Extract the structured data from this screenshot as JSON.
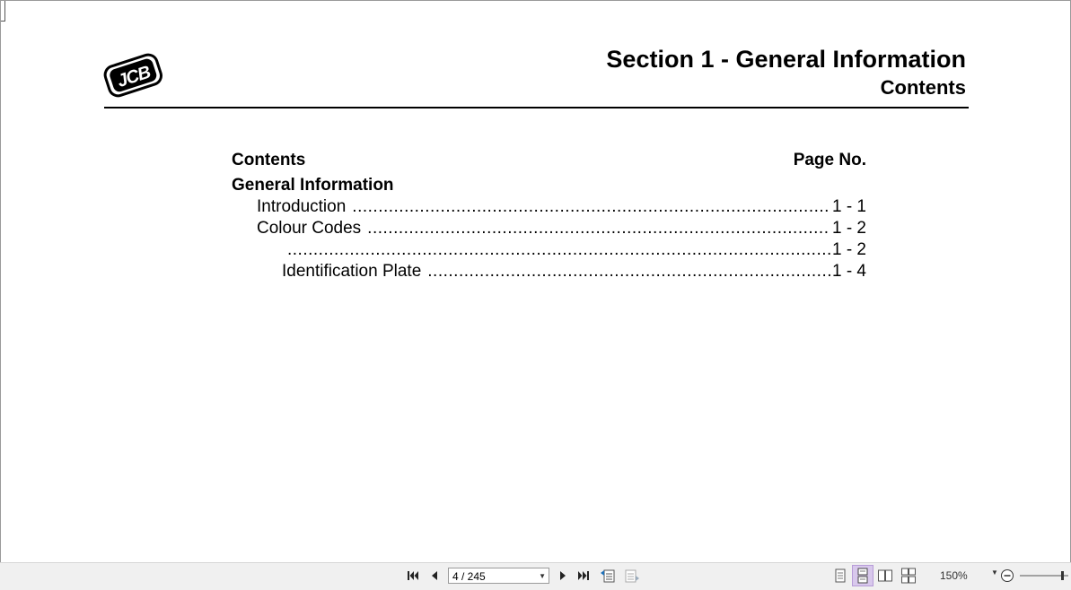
{
  "document": {
    "logo_text": "JCB",
    "section_title": "Section 1 - General Information",
    "section_subtitle": "Contents"
  },
  "toc": {
    "header_left": "Contents",
    "header_right": "Page No.",
    "group_title": "General Information",
    "entries": [
      {
        "label": "Introduction",
        "page": "1 - 1",
        "level": 1
      },
      {
        "label": "Colour Codes",
        "page": "1 - 2",
        "level": 1
      },
      {
        "label": "",
        "page": "1 - 2",
        "level": 2
      },
      {
        "label": "Identification Plate",
        "page": "1 - 4",
        "level": 2
      }
    ]
  },
  "toolbar": {
    "page_indicator": "4 / 245",
    "zoom_level": "150%",
    "icons": [
      "first-page-icon",
      "previous-page-icon",
      "page-dropdown-icon",
      "next-page-icon",
      "last-page-icon",
      "previous-view-icon",
      "next-view-icon",
      "single-page-view-icon",
      "continuous-view-icon",
      "two-page-view-icon",
      "two-page-continuous-icon",
      "zoom-dropdown-icon",
      "zoom-out-icon",
      "zoom-slider"
    ]
  }
}
